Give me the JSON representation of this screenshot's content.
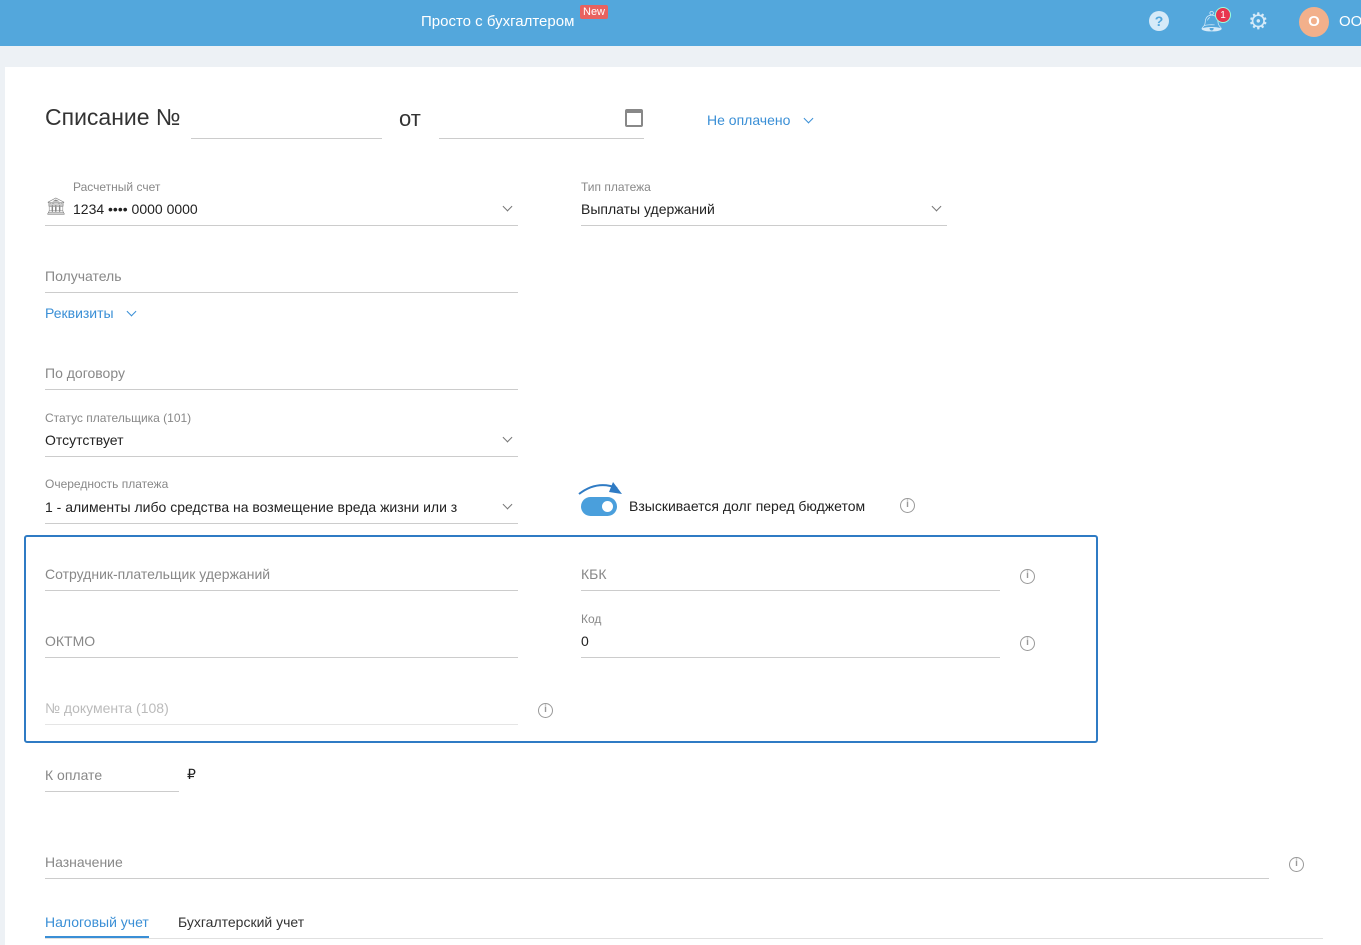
{
  "header": {
    "brand": "Просто с бухгалтером",
    "new_badge": "New",
    "notif_count": "1",
    "avatar_letter": "О",
    "user": "ОО"
  },
  "form": {
    "title": "Списание №",
    "number": "",
    "from_label": "от",
    "date": "",
    "status": "Не оплачено",
    "account_label": "Расчетный счет",
    "account_value": "1234 •••• 0000 0000",
    "payment_type_label": "Тип платежа",
    "payment_type_value": "Выплаты удержаний",
    "recipient_placeholder": "Получатель",
    "requisites_link": "Реквизиты",
    "contract_placeholder": "По договору",
    "payer_status_label": "Статус плательщика (101)",
    "payer_status_value": "Отсутствует",
    "priority_label": "Очередность платежа",
    "priority_value": "1 - алименты либо средства на возмещение вреда жизни или з",
    "debt_toggle_label": "Взыскивается долг перед бюджетом",
    "debt_toggle_on": true,
    "employee_placeholder": "Сотрудник-плательщик удержаний",
    "kbk_placeholder": "КБК",
    "oktmo_placeholder": "ОКТМО",
    "code_label": "Код",
    "code_value": "0",
    "doc_placeholder": "№ документа (108)",
    "amount_placeholder": "К оплате",
    "currency": "₽",
    "purpose_placeholder": "Назначение",
    "tabs": [
      "Налоговый учет",
      "Бухгалтерский учет"
    ],
    "active_tab": 0,
    "accent": "#3a8fd6",
    "highlight_border": "#2f7bc4"
  }
}
